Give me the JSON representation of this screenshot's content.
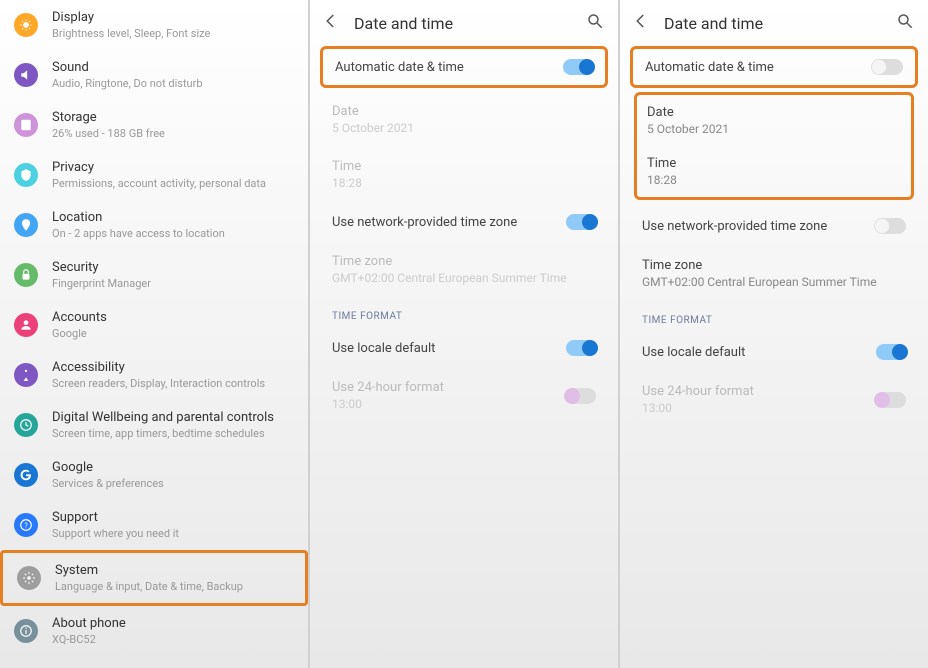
{
  "pane1": {
    "items": [
      {
        "title": "Display",
        "subtitle": "Brightness level, Sleep, Font size",
        "icon": "display-icon",
        "colorClass": "c-orange"
      },
      {
        "title": "Sound",
        "subtitle": "Audio, Ringtone, Do not disturb",
        "icon": "sound-icon",
        "colorClass": "c-purple"
      },
      {
        "title": "Storage",
        "subtitle": "26% used - 188 GB free",
        "icon": "storage-icon",
        "colorClass": "c-lightpurple"
      },
      {
        "title": "Privacy",
        "subtitle": "Permissions, account activity, personal data",
        "icon": "privacy-icon",
        "colorClass": "c-teal"
      },
      {
        "title": "Location",
        "subtitle": "On - 2 apps have access to location",
        "icon": "location-icon",
        "colorClass": "c-blue"
      },
      {
        "title": "Security",
        "subtitle": "Fingerprint Manager",
        "icon": "security-icon",
        "colorClass": "c-green"
      },
      {
        "title": "Accounts",
        "subtitle": "Google",
        "icon": "accounts-icon",
        "colorClass": "c-pink"
      },
      {
        "title": "Accessibility",
        "subtitle": "Screen readers, Display, Interaction controls",
        "icon": "accessibility-icon",
        "colorClass": "c-deeppurple"
      },
      {
        "title": "Digital Wellbeing and parental controls",
        "subtitle": "Screen time, app timers, bedtime schedules",
        "icon": "wellbeing-icon",
        "colorClass": "c-green2"
      },
      {
        "title": "Google",
        "subtitle": "Services & preferences",
        "icon": "google-icon",
        "colorClass": "c-bluegoogle"
      },
      {
        "title": "Support",
        "subtitle": "Support where you need it",
        "icon": "support-icon",
        "colorClass": "c-bluehelp"
      },
      {
        "title": "System",
        "subtitle": "Language & input, Date & time, Backup",
        "icon": "system-icon",
        "colorClass": "c-grey",
        "highlighted": true
      },
      {
        "title": "About phone",
        "subtitle": "XQ-BC52",
        "icon": "about-icon",
        "colorClass": "c-bluegrey"
      }
    ]
  },
  "pane2": {
    "header": "Date and time",
    "autoDateTime": {
      "label": "Automatic date & time",
      "on": true,
      "highlighted": true
    },
    "date": {
      "label": "Date",
      "value": "5 October 2021"
    },
    "time": {
      "label": "Time",
      "value": "18:28"
    },
    "networkTz": {
      "label": "Use network-provided time zone",
      "on": true
    },
    "timezone": {
      "label": "Time zone",
      "value": "GMT+02:00 Central European Summer Time"
    },
    "sectionFormat": "TIME FORMAT",
    "localeDefault": {
      "label": "Use locale default",
      "on": true
    },
    "use24h": {
      "label": "Use 24-hour format",
      "value": "13:00",
      "disabled": true
    }
  },
  "pane3": {
    "header": "Date and time",
    "autoDateTime": {
      "label": "Automatic date & time",
      "on": false,
      "highlighted": true
    },
    "date": {
      "label": "Date",
      "value": "5 October 2021"
    },
    "time": {
      "label": "Time",
      "value": "18:28"
    },
    "networkTz": {
      "label": "Use network-provided time zone",
      "on": false
    },
    "timezone": {
      "label": "Time zone",
      "value": "GMT+02:00 Central European Summer Time"
    },
    "sectionFormat": "TIME FORMAT",
    "localeDefault": {
      "label": "Use locale default",
      "on": true
    },
    "use24h": {
      "label": "Use 24-hour format",
      "value": "13:00",
      "disabled": true
    }
  }
}
